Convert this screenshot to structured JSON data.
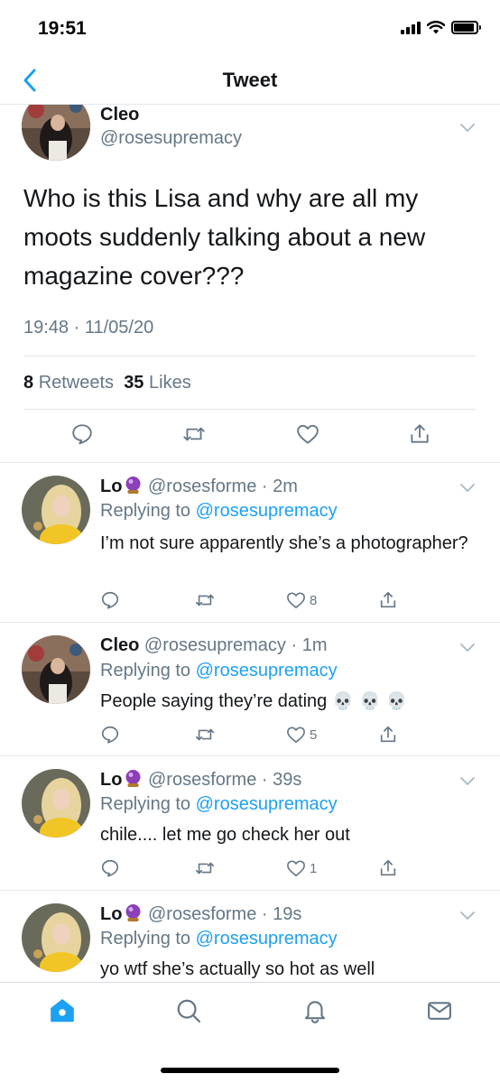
{
  "status_bar": {
    "time": "19:51"
  },
  "header": {
    "title": "Tweet"
  },
  "main_tweet": {
    "author_name": "Cleo",
    "author_handle": "@rosesupremacy",
    "text": "Who is this Lisa and why are all my moots suddenly talking about a new magazine cover???",
    "timestamp": "19:48 · 11/05/20",
    "retweets_count": "8",
    "retweets_label": "Retweets",
    "likes_count": "35",
    "likes_label": "Likes"
  },
  "replies": [
    {
      "name": "Lo",
      "handle": "@rosesforme",
      "time": "· 2m",
      "replying_label": "Replying to",
      "replying_handle": "@rosesupremacy",
      "text": "I’m not sure apparently she’s a photographer?",
      "likes": "8"
    },
    {
      "name": "Cleo",
      "handle": "@rosesupremacy",
      "time": "· 1m",
      "replying_label": "Replying to",
      "replying_handle": "@rosesupremacy",
      "text": "People saying they’re dating",
      "emoji": "💀 💀 💀",
      "likes": "5"
    },
    {
      "name": "Lo",
      "handle": "@rosesforme",
      "time": "· 39s",
      "replying_label": "Replying to",
      "replying_handle": "@rosesupremacy",
      "text": "chile.... let me go check her out",
      "likes": "1"
    },
    {
      "name": "Lo",
      "handle": "@rosesforme",
      "time": "· 19s",
      "replying_label": "Replying to",
      "replying_handle": "@rosesupremacy",
      "text": "yo wtf she’s actually so hot as well",
      "likes": ""
    }
  ],
  "icons": {
    "back": "chevron-left-icon",
    "reply": "comment-icon",
    "retweet": "retweet-icon",
    "like": "heart-icon",
    "share": "share-icon",
    "more": "chevron-down-icon",
    "tabs": [
      "home-icon",
      "search-icon",
      "bell-icon",
      "mail-icon"
    ]
  },
  "colors": {
    "accent": "#1da1f2",
    "text": "#14171a",
    "muted": "#657786",
    "divider": "#e1e8ed"
  }
}
